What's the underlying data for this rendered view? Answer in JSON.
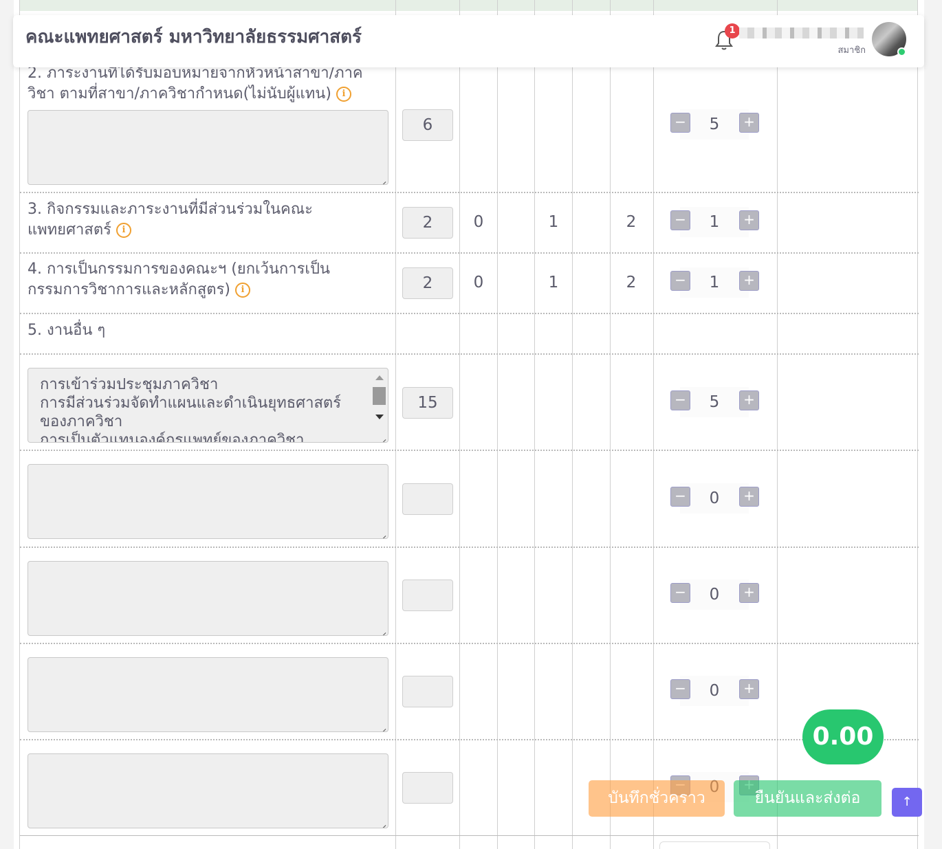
{
  "header": {
    "title": "คณะแพทยศาสตร์ มหาวิทยาลัยธรรมศาสตร์",
    "notification_count": "1",
    "user_role": "สมาชิก"
  },
  "rows": [
    {
      "label_line1": "2. ภาระงานที่ได้รับมอบหมายจากหัวหน้าสาขา/ภาค",
      "label_line2": "วิชา ตามที่สาขา/ภาควิชากำหนด(ไม่นับผู้แทน)",
      "hours": "6",
      "stepper": "5"
    },
    {
      "label_line1": "3. กิจกรรมและภาระงานที่มีส่วนร่วมในคณะ",
      "label_line2": "แพทยศาสตร์",
      "hours": "2",
      "col_a": "0",
      "col_b": "1",
      "col_c": "2",
      "stepper": "1"
    },
    {
      "label_line1": "4. การเป็นกรรมการของคณะฯ (ยกเว้นการเป็น",
      "label_line2": "กรรมการวิชาการและหลักสูตร)",
      "hours": "2",
      "col_a": "0",
      "col_b": "1",
      "col_c": "2",
      "stepper": "1"
    },
    {
      "label_line1": "5. งานอื่น ๆ"
    }
  ],
  "other_tasks": [
    {
      "text_line1": "การเข้าร่วมประชุมภาควิชา",
      "text_line2": "การมีส่วนร่วมจัดทำแผนและดำเนินยุทธศาสตร์",
      "text_line3": "ของภาควิชา",
      "text_line4": "การเป็นตัวแทนองค์กรแพทย์ของภาควิชา",
      "hours": "15",
      "stepper": "5"
    },
    {
      "text_line1": "",
      "hours": "",
      "stepper": "0"
    },
    {
      "text_line1": "",
      "hours": "",
      "stepper": "0"
    },
    {
      "text_line1": "",
      "hours": "",
      "stepper": "0"
    },
    {
      "text_line1": "",
      "hours": "",
      "stepper": "0"
    }
  ],
  "stepper_minus": "−",
  "stepper_plus": "+",
  "info_glyph": "i",
  "score": "0.00",
  "buttons": {
    "save_draft": "บันทึกชั่วคราว",
    "confirm_submit": "ยืนยันและส่งต่อ",
    "scroll_top": "↑"
  },
  "colors": {
    "score_bg": "#28c76f",
    "draft_bg": "#ff9f43",
    "submit_bg": "#28c76f",
    "scroll_top_bg": "#7367f0",
    "badge_bg": "#e8464c",
    "info_icon": "#f0a030"
  },
  "icons": {
    "bell": "bell-icon",
    "info": "info-circle-icon",
    "scroll_top": "arrow-up-icon",
    "resize": "resize-grip-icon"
  }
}
